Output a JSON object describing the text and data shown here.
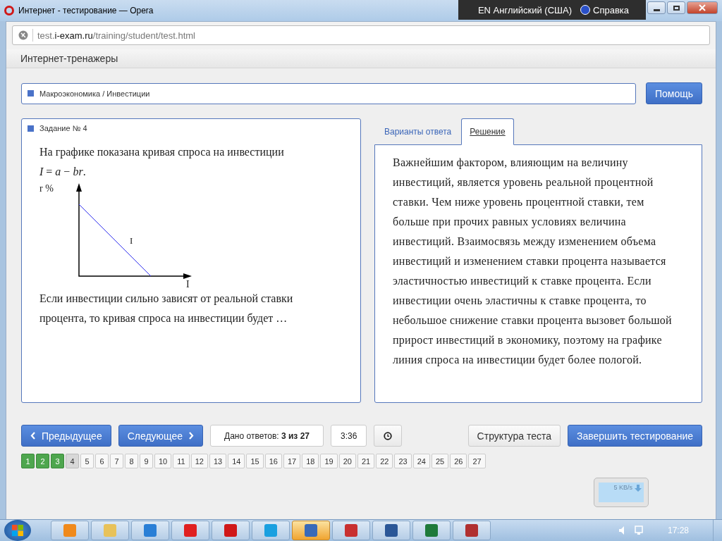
{
  "window": {
    "title": "Интернет - тестирование — Opera"
  },
  "language_bar": {
    "language": "EN Английский (США)",
    "help": "Справка"
  },
  "address": {
    "prefix": "test.",
    "domain": "i-exam.ru",
    "path": "/training/student/test.html"
  },
  "app_title": "Интернет-тренажеры",
  "breadcrumb": "Макроэкономика / Инвестиции",
  "help_button": "Помощь",
  "task": {
    "title": "Задание № 4",
    "text_before": "На графике показана кривая спроса на инвестиции",
    "formula": "*I* = *a* − *br*.",
    "y_axis_label": "r %",
    "curve_label": "I",
    "x_axis_label": "I",
    "text_after": "Если инвестиции сильно зависят от реальной ставки процента, то кривая спроса на инвестиции будет …"
  },
  "tabs": [
    {
      "label": "Варианты ответа",
      "selected": false
    },
    {
      "label": "Решение",
      "selected": true
    }
  ],
  "solution": "Важнейшим фактором, влияющим на величину инвестиций, является уровень реальной процентной ставки. Чем ниже уровень процентной ставки, тем больше при прочих равных условиях величина инвестиций. Взаимосвязь между изменением объема инвестиций и изменением ставки процента называется эластичностью инвестиций к ставке процента. Если инвестиции очень эластичны к ставке процента, то небольшое снижение ставки процента вызовет большой прирост инвестиций в экономику, поэтому на графике линия спроса на инвестиции будет более пологой.",
  "nav": {
    "prev": "Предыдущее",
    "next": "Следующее",
    "answered_label": "Дано ответов:",
    "answered_value": "3 из 27",
    "timer": "3:36",
    "structure": "Структура теста",
    "finish": "Завершить тестирование"
  },
  "pages": [
    {
      "label": "1",
      "answered": true,
      "selected": false
    },
    {
      "label": "2",
      "answered": true,
      "selected": false
    },
    {
      "label": "3",
      "answered": true,
      "selected": false
    },
    {
      "label": "4",
      "answered": false,
      "selected": true
    },
    {
      "label": "5",
      "answered": false,
      "selected": false
    },
    {
      "label": "6",
      "answered": false,
      "selected": false
    },
    {
      "label": "7",
      "answered": false,
      "selected": false
    },
    {
      "label": "8",
      "answered": false,
      "selected": false
    },
    {
      "label": "9",
      "answered": false,
      "selected": false
    },
    {
      "label": "10",
      "answered": false,
      "selected": false
    },
    {
      "label": "11",
      "answered": false,
      "selected": false
    },
    {
      "label": "12",
      "answered": false,
      "selected": false
    },
    {
      "label": "13",
      "answered": false,
      "selected": false
    },
    {
      "label": "14",
      "answered": false,
      "selected": false
    },
    {
      "label": "15",
      "answered": false,
      "selected": false
    },
    {
      "label": "16",
      "answered": false,
      "selected": false
    },
    {
      "label": "17",
      "answered": false,
      "selected": false
    },
    {
      "label": "18",
      "answered": false,
      "selected": false
    },
    {
      "label": "19",
      "answered": false,
      "selected": false
    },
    {
      "label": "20",
      "answered": false,
      "selected": false
    },
    {
      "label": "21",
      "answered": false,
      "selected": false
    },
    {
      "label": "22",
      "answered": false,
      "selected": false
    },
    {
      "label": "23",
      "answered": false,
      "selected": false
    },
    {
      "label": "24",
      "answered": false,
      "selected": false
    },
    {
      "label": "25",
      "answered": false,
      "selected": false
    },
    {
      "label": "26",
      "answered": false,
      "selected": false
    },
    {
      "label": "27",
      "answered": false,
      "selected": false
    }
  ],
  "network_widget": {
    "speed": "5 KB/s"
  },
  "taskbar": {
    "apps": [
      {
        "kind": "media",
        "active": false
      },
      {
        "kind": "folder",
        "active": false
      },
      {
        "kind": "ie",
        "active": false
      },
      {
        "kind": "yandex",
        "active": false
      },
      {
        "kind": "opera",
        "active": false
      },
      {
        "kind": "skype",
        "active": false
      },
      {
        "kind": "shield",
        "active": true
      },
      {
        "kind": "cards",
        "active": false
      },
      {
        "kind": "word",
        "active": false
      },
      {
        "kind": "excel",
        "active": false
      },
      {
        "kind": "game",
        "active": false
      }
    ],
    "clock": "17:28"
  }
}
